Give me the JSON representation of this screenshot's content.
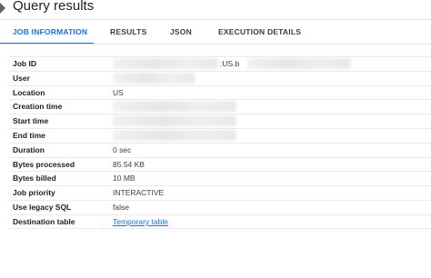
{
  "header": {
    "title": "Query results",
    "icon": "expand-icon"
  },
  "tabs": [
    {
      "label": "JOB INFORMATION",
      "active": true
    },
    {
      "label": "RESULTS"
    },
    {
      "label": "JSON"
    },
    {
      "label": "EXECUTION DETAILS"
    }
  ],
  "details": {
    "job_id": {
      "label": "Job ID",
      "value": ":US.b"
    },
    "user": {
      "label": "User"
    },
    "location": {
      "label": "Location",
      "value": "US"
    },
    "creation_time": {
      "label": "Creation time"
    },
    "start_time": {
      "label": "Start time"
    },
    "end_time": {
      "label": "End time"
    },
    "duration": {
      "label": "Duration",
      "value": "0 sec"
    },
    "bytes_processed": {
      "label": "Bytes processed",
      "value": "85.54 KB"
    },
    "bytes_billed": {
      "label": "Bytes billed",
      "value": "10 MB"
    },
    "job_priority": {
      "label": "Job priority",
      "value": "INTERACTIVE"
    },
    "use_legacy_sql": {
      "label": "Use legacy SQL",
      "value": "false"
    },
    "destination_table": {
      "label": "Destination table",
      "value": "Temporary table"
    }
  },
  "colors": {
    "accent": "#1a73e8",
    "text": "#202124"
  }
}
